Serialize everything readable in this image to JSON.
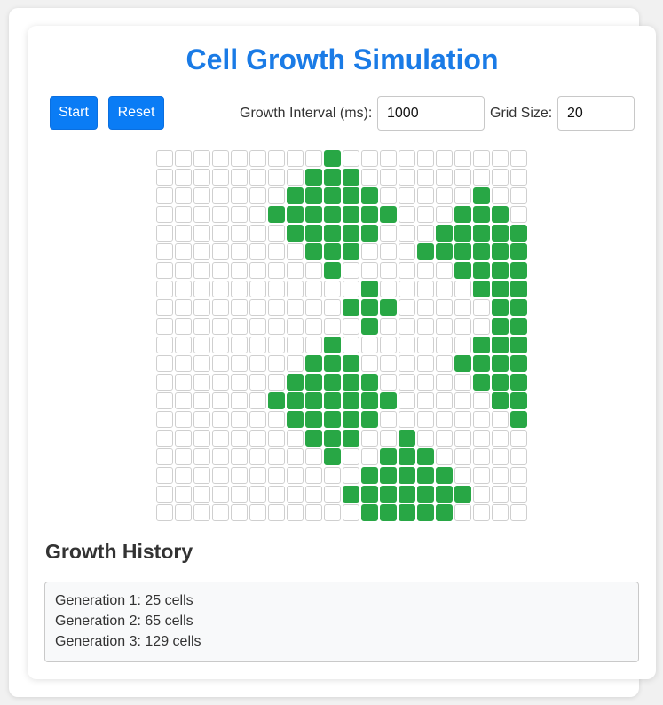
{
  "title": "Cell Growth Simulation",
  "controls": {
    "start_label": "Start",
    "reset_label": "Reset",
    "interval_label": "Growth Interval (ms):",
    "interval_value": "1000",
    "grid_size_label": "Grid Size:",
    "grid_size_value": "20"
  },
  "grid": {
    "rows": 20,
    "cols": 20,
    "alive_color": "#28a745",
    "alive": [
      "..,,.....X..........",
      "........XXX.........",
      "...... XXXXX.....X..",
      "......XXXXXXX...XXX.",
      ".......XXXXX...XXXXX",
      "........XXX...XXXXXXX",
      ".........X......XXXXX",
      "...........X.....XXX",
      "..........XXX.....XX",
      "...........X......XXX",
      ".........X.......XXXXX",
      "........XXX.....XXXXXXX",
      ".......XXXXX.....XXXXX",
      "......XXXXXXX.....XXX",
      ".......XXXXX.......X",
      "........XXX..X......",
      ".........X..XXX.....",
      "...........XXXXX....",
      "..........XXXXXXX...",
      "...........XXXXX...."
    ]
  },
  "history": {
    "title": "Growth History",
    "entries": [
      "Generation 1: 25 cells",
      "Generation 2: 65 cells",
      "Generation 3: 129 cells"
    ]
  }
}
